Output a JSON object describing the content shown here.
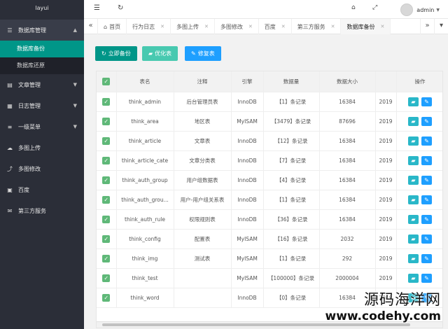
{
  "app": {
    "logo": "layui"
  },
  "sidebar": {
    "groups": [
      {
        "label": "数据库管理",
        "icon": "database-icon",
        "open": true,
        "items": [
          {
            "label": "数据库备份",
            "active": true
          },
          {
            "label": "数据库还原",
            "active": false
          }
        ]
      },
      {
        "label": "文章管理",
        "icon": "document-icon"
      },
      {
        "label": "日志管理",
        "icon": "calendar-icon"
      },
      {
        "label": "一级菜单",
        "icon": "layers-icon"
      },
      {
        "label": "多图上传",
        "icon": "cloud-upload-icon"
      },
      {
        "label": "多图修改",
        "icon": "share-icon"
      },
      {
        "label": "百度",
        "icon": "image-icon"
      },
      {
        "label": "第三方服务",
        "icon": "mail-icon"
      }
    ]
  },
  "topbar": {
    "username": "admin"
  },
  "tabs": [
    {
      "label": "首页",
      "active": false
    },
    {
      "label": "行为日志",
      "active": false
    },
    {
      "label": "多图上传",
      "active": false
    },
    {
      "label": "多图修改",
      "active": false
    },
    {
      "label": "百度",
      "active": false
    },
    {
      "label": "第三方服务",
      "active": false
    },
    {
      "label": "数据库备份",
      "active": true
    }
  ],
  "toolbar": {
    "backup_label": "立即备份",
    "optimize_label": "优化表",
    "repair_label": "修复表"
  },
  "table": {
    "headers": [
      "表名",
      "注释",
      "引擎",
      "数据量",
      "数据大小",
      "",
      "操作"
    ],
    "rows": [
      [
        "think_admin",
        "后台管理员表",
        "InnoDB",
        "【1】条记录",
        "16384",
        "2019"
      ],
      [
        "think_area",
        "地区表",
        "MyISAM",
        "【3479】条记录",
        "87696",
        "2019"
      ],
      [
        "think_article",
        "文章表",
        "InnoDB",
        "【12】条记录",
        "16384",
        "2019"
      ],
      [
        "think_article_cate",
        "文章分类表",
        "InnoDB",
        "【7】条记录",
        "16384",
        "2019"
      ],
      [
        "think_auth_group",
        "用户组数据表",
        "InnoDB",
        "【4】条记录",
        "16384",
        "2019"
      ],
      [
        "think_auth_grou...",
        "用户-用户组关系表",
        "InnoDB",
        "【1】条记录",
        "16384",
        "2019"
      ],
      [
        "think_auth_rule",
        "权限规则表",
        "InnoDB",
        "【36】条记录",
        "16384",
        "2019"
      ],
      [
        "think_config",
        "配置表",
        "MyISAM",
        "【16】条记录",
        "2032",
        "2019"
      ],
      [
        "think_img",
        "测试表",
        "MyISAM",
        "【1】条记录",
        "292",
        "2019"
      ],
      [
        "think_test",
        "",
        "MyISAM",
        "【100000】条记录",
        "2000004",
        "2019"
      ],
      [
        "think_word",
        "",
        "InnoDB",
        "【0】条记录",
        "16384",
        "2019"
      ]
    ]
  },
  "watermark": {
    "cn": "源码海洋网",
    "url": "www.codehy.com"
  },
  "colors": {
    "sidebar": "#2b2e38",
    "accent": "#009688",
    "check": "#5fb878",
    "blue": "#1e9fff",
    "cyan": "#29b7c8"
  }
}
